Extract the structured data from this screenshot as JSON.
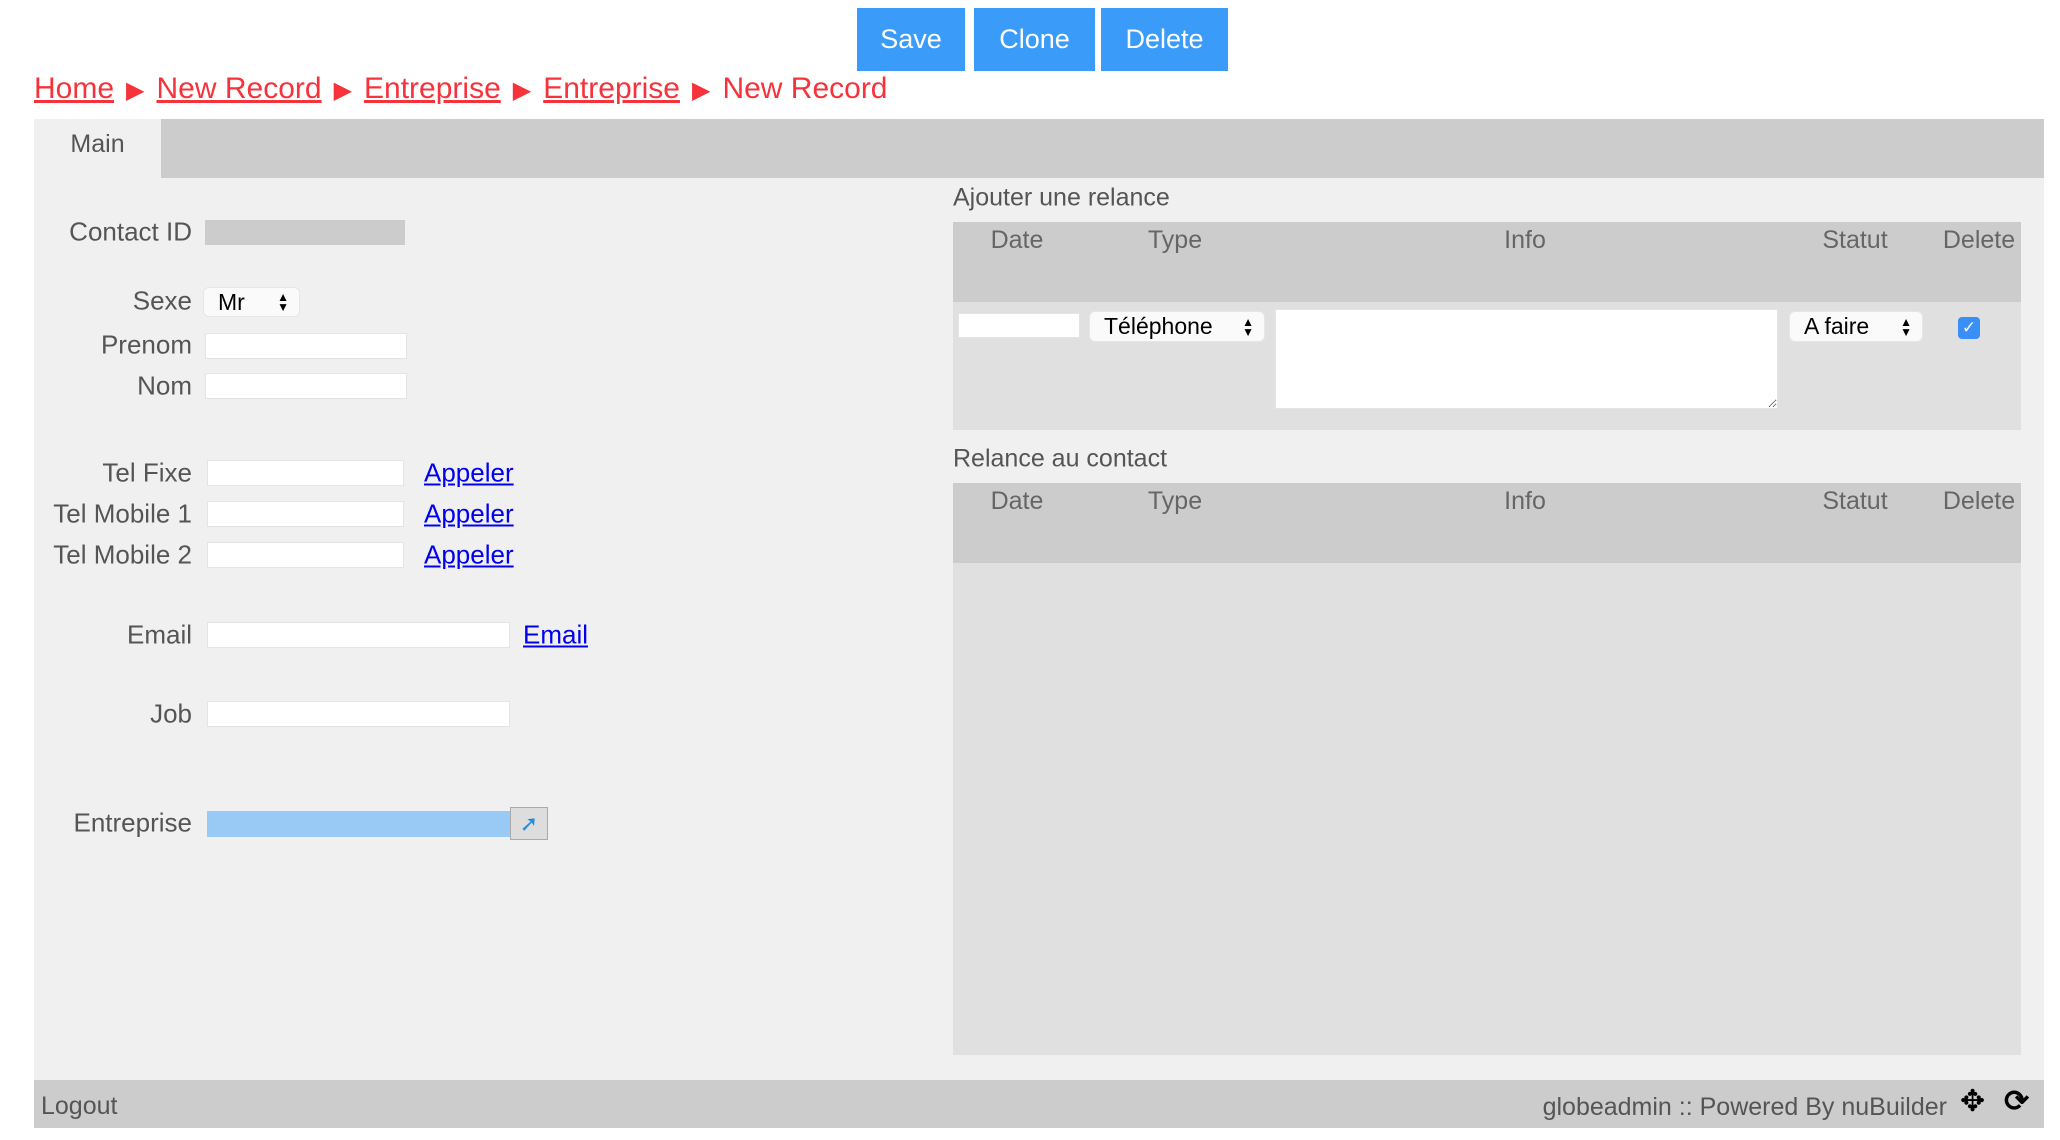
{
  "toolbar": {
    "save": "Save",
    "clone": "Clone",
    "delete": "Delete"
  },
  "breadcrumb": [
    {
      "label": "Home"
    },
    {
      "label": "New Record"
    },
    {
      "label": "Entreprise"
    },
    {
      "label": "Entreprise"
    },
    {
      "label": "New Record"
    }
  ],
  "breadcrumb_separator": "▶",
  "tabs": [
    {
      "label": "Main"
    }
  ],
  "form": {
    "contact_id": {
      "label": "Contact ID",
      "value": ""
    },
    "sexe": {
      "label": "Sexe",
      "value": "Mr"
    },
    "prenom": {
      "label": "Prenom",
      "value": ""
    },
    "nom": {
      "label": "Nom",
      "value": ""
    },
    "tel_fixe": {
      "label": "Tel Fixe",
      "value": "",
      "link": "Appeler"
    },
    "tel_mobile_1": {
      "label": "Tel Mobile 1",
      "value": "",
      "link": "Appeler"
    },
    "tel_mobile_2": {
      "label": "Tel Mobile 2",
      "value": "",
      "link": "Appeler"
    },
    "email": {
      "label": "Email",
      "value": "",
      "link": "Email"
    },
    "job": {
      "label": "Job",
      "value": ""
    },
    "entreprise": {
      "label": "Entreprise",
      "value": ""
    }
  },
  "ajouter": {
    "title": "Ajouter une relance",
    "columns": [
      "Date",
      "Type",
      "Info",
      "Statut",
      "Delete"
    ],
    "row": {
      "date": "",
      "type": "Téléphone",
      "info": "",
      "statut": "A faire",
      "delete": true
    }
  },
  "relance": {
    "title": "Relance au contact",
    "columns": [
      "Date",
      "Type",
      "Info",
      "Statut",
      "Delete"
    ]
  },
  "footer": {
    "logout": "Logout",
    "status": "globeadmin :: Powered By nuBuilder"
  },
  "colors": {
    "accent": "#3a9cf8",
    "breadcrumb": "#f6333b",
    "lookup": "#99c9f5"
  }
}
